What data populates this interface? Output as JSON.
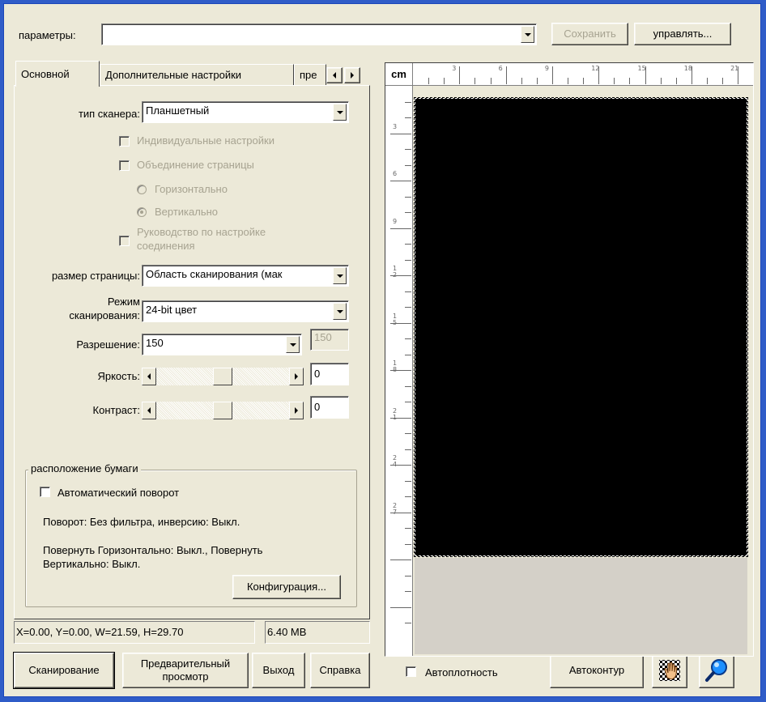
{
  "profile": {
    "label": "параметры:",
    "value": "",
    "save_label": "Сохранить",
    "manage_label": "управлять..."
  },
  "tabs": [
    "Основной",
    "Дополнительные настройки",
    "пре"
  ],
  "scanner": {
    "type_label": "тип сканера:",
    "type_value": "Планшетный",
    "individual_settings": "Индивидуальные настройки",
    "page_merge": "Объединение страницы",
    "horizontal": "Горизонтально",
    "vertical": "Вертикально",
    "connection_guide_line1": "Руководство по настройке",
    "connection_guide_line2": "соединения",
    "page_size_label": "размер страницы:",
    "page_size_value": "Область сканирования (мак",
    "mode_label_line1": "Режим",
    "mode_label_line2": "сканирования:",
    "mode_value": "24-bit цвет",
    "resolution_label": "Разрешение:",
    "resolution_value": "150",
    "resolution_custom": "150",
    "brightness_label": "Яркость:",
    "brightness_value": "0",
    "brightness_level": 0.5,
    "contrast_label": "Контраст:",
    "contrast_value": "0",
    "contrast_level": 0.5
  },
  "paper": {
    "group_title": "расположение бумаги",
    "auto_rotate": "Автоматический поворот",
    "rotation_info": "Поворот: Без фильтра, инверсию: Выкл.",
    "flip_info_line1": "Повернуть Горизонтально: Выкл., Повернуть",
    "flip_info_line2": "Вертикально: Выкл.",
    "config_label": "Конфигурация..."
  },
  "status": {
    "coords": "X=0.00, Y=0.00, W=21.59, H=29.70",
    "size": "6.40 MB"
  },
  "buttons": {
    "scan": "Сканирование",
    "preview_line1": "Предварительный",
    "preview_line2": "просмотр",
    "exit": "Выход",
    "help": "Справка",
    "auto_density": "Автоплотность",
    "auto_contour": "Автоконтур"
  },
  "ruler": {
    "unit": "cm",
    "top_labels": [
      "3",
      "6",
      "9",
      "12",
      "15",
      "18",
      "21"
    ],
    "left_labels": [
      "3",
      "6",
      "9",
      "12",
      "15",
      "18",
      "21",
      "24",
      "27"
    ]
  },
  "colors": {
    "window_bg": "#ece9d8",
    "frame": "#2f5cc8",
    "preview_image": "#000000",
    "preview_empty": "#d4d0c8"
  }
}
